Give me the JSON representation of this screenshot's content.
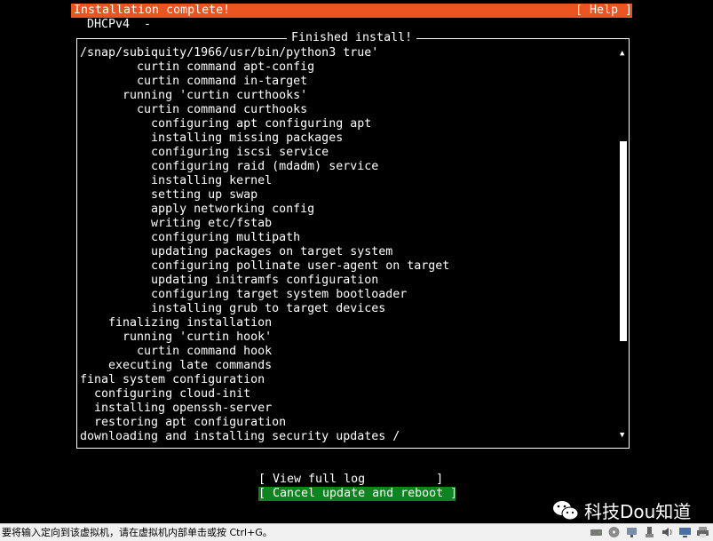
{
  "header": {
    "title": "Installation complete!",
    "help_label": "[ Help ]"
  },
  "network_label": "DHCPv4  -",
  "dialog": {
    "title": "Finished install!",
    "log_lines": [
      "/snap/subiquity/1966/usr/bin/python3 true'",
      "        curtin command apt-config",
      "        curtin command in-target",
      "      running 'curtin curthooks'",
      "        curtin command curthooks",
      "          configuring apt configuring apt",
      "          installing missing packages",
      "          configuring iscsi service",
      "          configuring raid (mdadm) service",
      "          installing kernel",
      "          setting up swap",
      "          apply networking config",
      "          writing etc/fstab",
      "          configuring multipath",
      "          updating packages on target system",
      "          configuring pollinate user-agent on target",
      "          updating initramfs configuration",
      "          configuring target system bootloader",
      "          installing grub to target devices",
      "    finalizing installation",
      "      running 'curtin hook'",
      "        curtin command hook",
      "    executing late commands",
      "final system configuration",
      "  configuring cloud-init",
      "  installing openssh-server",
      "  restoring apt configuration",
      "downloading and installing security updates /"
    ],
    "scroll_position": 0.48
  },
  "buttons": {
    "view_log": "[ View full log          ]",
    "cancel_reboot": "[ Cancel update and reboot ]"
  },
  "watermark": "科技Dou知道",
  "statusbar": {
    "hint": "要将输入定向到该虚拟机，请在虚拟机内部单击或按 Ctrl+G。",
    "icons": [
      "hard-disk-icon",
      "cd-drive-icon",
      "network-icon",
      "usb-icon",
      "sound-icon",
      "display-icon",
      "printer-icon"
    ]
  },
  "colors": {
    "title_bar": "#e95420",
    "selected_button": "#0e8420",
    "background": "#000000"
  }
}
